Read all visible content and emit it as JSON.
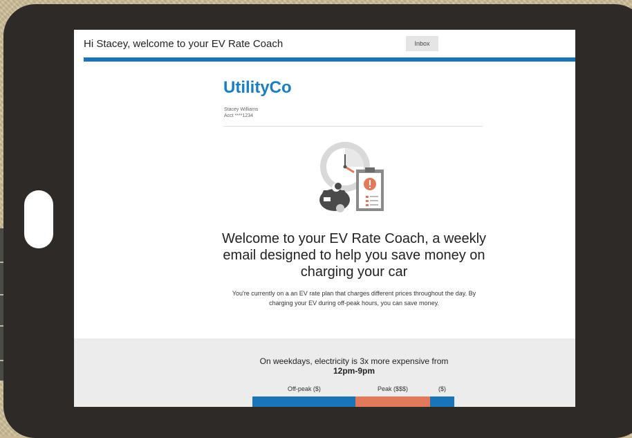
{
  "email": {
    "subject": "Hi Stacey, welcome to your EV Rate Coach",
    "folder_chip": "Inbox"
  },
  "brand": {
    "name": "UtilityCo",
    "color": "#1a7fc2"
  },
  "account": {
    "name": "Stacey Williams",
    "number": "Acct ****1234"
  },
  "content": {
    "headline": "Welcome to your EV Rate Coach, a weekly email designed to help you save money on charging your car",
    "intro": "You're currently on a an EV rate plan that charges different prices throughout the day. By charging your EV during off-peak hours, you can save money."
  },
  "rate_panel": {
    "text_prefix": "On weekdays, electricity is 3x more expensive from",
    "peak_hours": "12pm-9pm",
    "segments": [
      {
        "label": "Off-peak ($)",
        "share": 0.51,
        "color": "#1a75b8"
      },
      {
        "label": "Peak ($$$)",
        "share": 0.37,
        "color": "#e07a5a"
      },
      {
        "label": "($)",
        "share": 0.12,
        "color": "#1a75b8"
      }
    ]
  },
  "icons": [
    "clock-icon",
    "moon-icon",
    "car-icon",
    "clipboard-icon",
    "alert-icon"
  ],
  "colors": {
    "accent_blue": "#1a75b8",
    "peak_orange": "#e07a5a",
    "device_frame": "#2d2a27"
  }
}
